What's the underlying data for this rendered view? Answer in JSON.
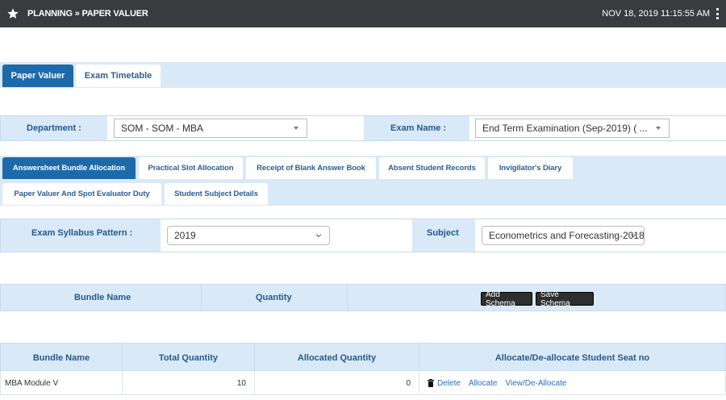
{
  "topbar": {
    "breadcrumb": "PLANNING » PAPER VALUER",
    "datetime": "NOV 18, 2019  11:15:55 AM",
    "star_icon": "star-icon",
    "menu_icon": "kebab-menu-icon"
  },
  "main_tabs": [
    {
      "label": "Paper Valuer",
      "active": true
    },
    {
      "label": "Exam Timetable",
      "active": false
    }
  ],
  "filters1": {
    "department_label": "Department :",
    "department_value": "SOM - SOM - MBA",
    "exam_label": "Exam Name :",
    "exam_value": "End Term Examination (Sep-2019) ( ..."
  },
  "sub_tabs": [
    {
      "label": "Answersheet Bundle Allocation",
      "active": true
    },
    {
      "label": "Practical Slot Allocation",
      "active": false
    },
    {
      "label": "Receipt of Blank Answer Book",
      "active": false
    },
    {
      "label": "Absent Student Records",
      "active": false
    },
    {
      "label": "Invigilator's Diary",
      "active": false
    },
    {
      "label": "Paper Valuer And Spot Evaluator Duty",
      "active": false
    },
    {
      "label": "Student Subject Details",
      "active": false
    }
  ],
  "filters2": {
    "pattern_label": "Exam Syllabus Pattern :",
    "pattern_value": "2019",
    "subject_label": "Subject",
    "subject_value": "Econometrics and Forecasting-2018"
  },
  "schema": {
    "col_bundle": "Bundle Name",
    "col_quantity": "Quantity",
    "add_label": "Add Schema",
    "save_label": "Save Schema"
  },
  "grid": {
    "headers": [
      "Bundle Name",
      "Total Quantity",
      "Allocated Quantity",
      "Allocate/De-allocate Student Seat no"
    ],
    "rows": [
      {
        "bundle": "MBA Module V",
        "total": "10",
        "allocated": "0",
        "delete": "Delete",
        "allocate": "Allocate",
        "view": "View/De-Allocate"
      }
    ]
  },
  "colors": {
    "topbar": "#3a3b3f",
    "accent": "#1d6aab",
    "panel": "#dae9f8",
    "link": "#2a6ebb"
  }
}
